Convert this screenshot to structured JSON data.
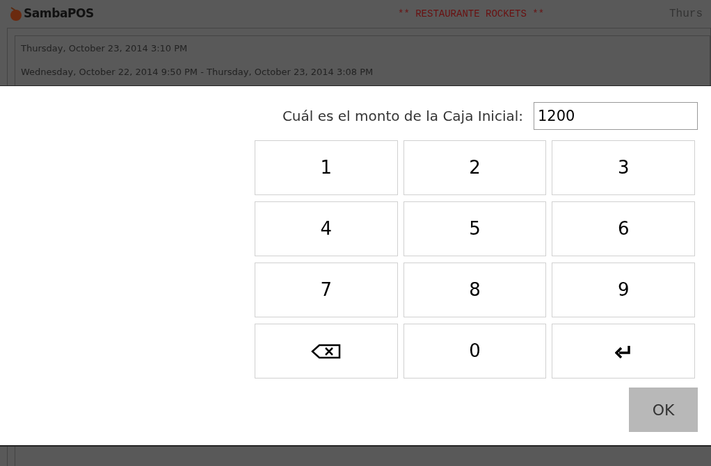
{
  "header": {
    "logo": "SambaPOS",
    "title": "** RESTAURANTE ROCKETS **",
    "date": "Thurs"
  },
  "periods": [
    "Thursday, October 23, 2014 3:10 PM",
    "Wednesday, October 22, 2014 9:50 PM - Thursday, October 23, 2014 3:08 PM"
  ],
  "dialog": {
    "prompt": "Cuál es el monto de la Caja Inicial:",
    "value": "1200",
    "keys": [
      {
        "kind": "digit",
        "label": "1"
      },
      {
        "kind": "digit",
        "label": "2"
      },
      {
        "kind": "digit",
        "label": "3"
      },
      {
        "kind": "digit",
        "label": "4"
      },
      {
        "kind": "digit",
        "label": "5"
      },
      {
        "kind": "digit",
        "label": "6"
      },
      {
        "kind": "digit",
        "label": "7"
      },
      {
        "kind": "digit",
        "label": "8"
      },
      {
        "kind": "digit",
        "label": "9"
      },
      {
        "kind": "backspace"
      },
      {
        "kind": "digit",
        "label": "0"
      },
      {
        "kind": "enter"
      }
    ],
    "ok": "OK"
  }
}
